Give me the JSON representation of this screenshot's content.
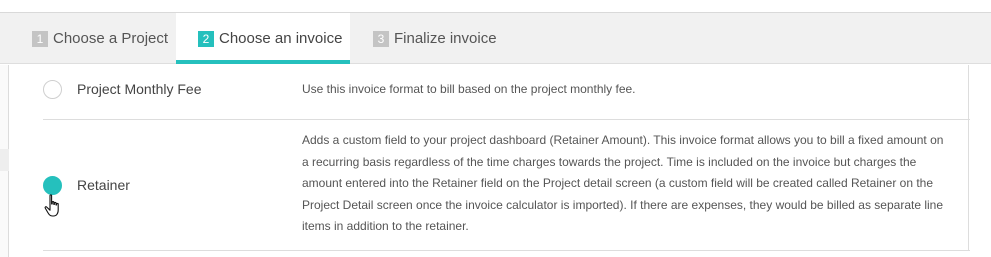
{
  "tabs": [
    {
      "num": "1",
      "label": "Choose a Project"
    },
    {
      "num": "2",
      "label": "Choose an invoice"
    },
    {
      "num": "3",
      "label": "Finalize invoice"
    }
  ],
  "active_tab": 1,
  "accent_color": "#25c0bd",
  "options": [
    {
      "label": "Project Monthly Fee",
      "description": "Use this invoice format to bill based on the project monthly fee.",
      "selected": false
    },
    {
      "label": "Retainer",
      "description": "Adds a custom field to your project dashboard (Retainer Amount). This invoice format allows you to bill a fixed amount on a recurring basis regardless of the time charges towards the project. Time is included on the invoice but charges the amount entered into the Retainer field on the Project detail screen (a custom field will be created called Retainer on the Project Detail screen once the invoice calculator is imported). If there are expenses, they would be billed as separate line items in addition to the retainer.",
      "selected": true
    }
  ],
  "cursor_icon": "hand-pointer-icon"
}
